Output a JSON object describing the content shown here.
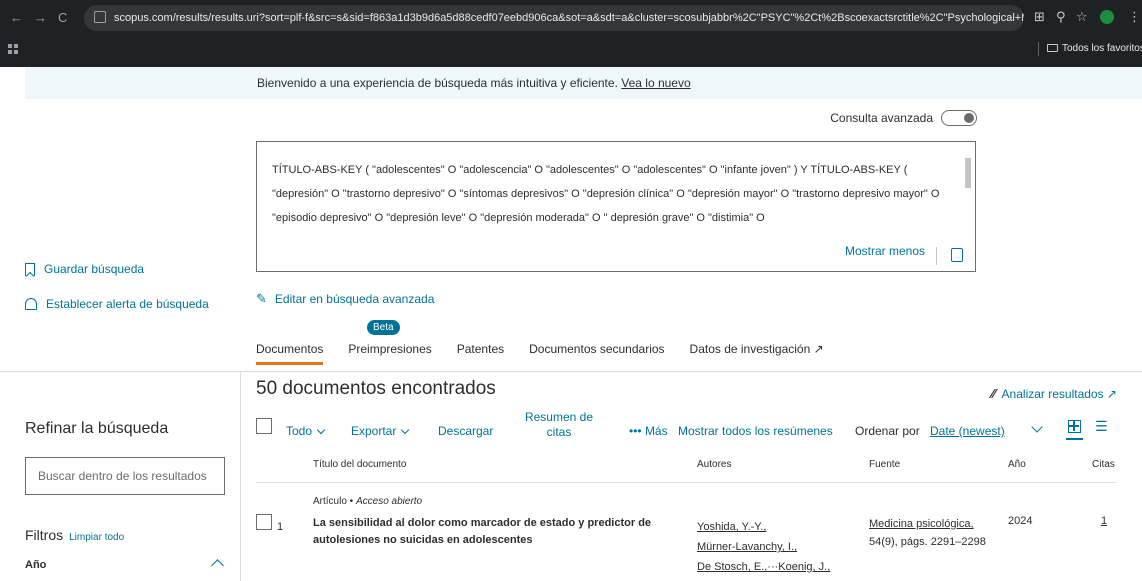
{
  "browser": {
    "back": "←",
    "forward": "→",
    "reload": "C",
    "url": "scopus.com/results/results.uri?sort=plf-f&src=s&sid=f863a1d3b9d6a5d88cedf07eebd906ca&sot=a&sdt=a&cluster=scosubjabbr%2C\"PSYC\"%2Ct%2Bscoexactsrctitle%2C\"Psychological+Med...",
    "bookmarks_label": "Todos los favoritos",
    "extension_letter": "s"
  },
  "banner": {
    "text": "Bienvenido a una experiencia de búsqueda más intuitiva y eficiente.",
    "link": "Vea lo nuevo"
  },
  "advanced_query": {
    "label": "Consulta avanzada"
  },
  "query": {
    "text": "TÍTULO-ABS-KEY ( \"adolescentes\" O \"adolescencia\" O \"adolescentes\" O \"adolescentes\" O \"infante joven\" ) Y TÍTULO-ABS-KEY ( \"depresión\" O \"trastorno depresivo\" O \"síntomas depresivos\" O \"depresión clínica\" O \"depresión mayor\" O \"trastorno depresivo mayor\" O \"episodio depresivo\" O \"depresión leve\" O \"depresión moderada\" O \" depresión grave\" O \"distimia\" O",
    "show_less": "Mostrar menos"
  },
  "sidebar_actions": {
    "save_search": "Guardar búsqueda",
    "set_alert": "Establecer alerta de búsqueda"
  },
  "edit_advanced": "Editar en búsqueda avanzada",
  "beta": "Beta",
  "tabs": [
    {
      "label": "Documentos"
    },
    {
      "label": "Preimpresiones"
    },
    {
      "label": "Patentes"
    },
    {
      "label": "Documentos secundarios"
    },
    {
      "label": "Datos de investigación ↗"
    }
  ],
  "refine": {
    "title": "Refinar la búsqueda",
    "search_placeholder": "Buscar dentro de los resultados",
    "filters": "Filtros",
    "clear_all": "Limpiar todo",
    "year": "Año"
  },
  "results": {
    "count": "50 documentos encontrados",
    "analyze": "Analizar resultados ↗",
    "toolbar": {
      "all": "Todo",
      "export": "Exportar",
      "download": "Descargar",
      "citation_summary": "Resumen de citas",
      "more": "••• Más",
      "show_abstracts": "Mostrar todos los resúmenes",
      "sort_by": "Ordenar por",
      "sort_value": "Date (newest)"
    },
    "columns": {
      "title": "Título del documento",
      "authors": "Autores",
      "source": "Fuente",
      "year": "Año",
      "cites": "Citas"
    },
    "rows": [
      {
        "type": "Artículo",
        "access": "Acceso abierto",
        "num": "1",
        "title": "La sensibilidad al dolor como marcador de estado y predictor de autolesiones no suicidas en adolescentes",
        "authors": [
          "Yoshida, Y.-Y.,",
          "Mürner-Lavanchy, I.,",
          "De Stosch, E.,···Koenig, J.,"
        ],
        "source_name": "Medicina psicológica,",
        "source_detail": "54(9), págs. 2291–2298",
        "year": "2024",
        "cites": "1"
      }
    ]
  }
}
